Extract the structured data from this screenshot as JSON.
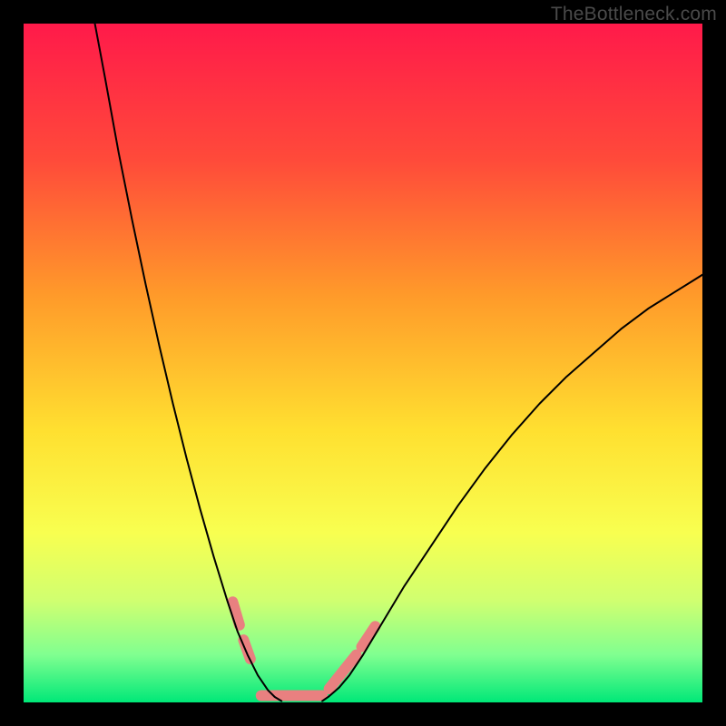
{
  "watermark": "TheBottleneck.com",
  "chart_data": {
    "type": "line",
    "title": "",
    "xlabel": "",
    "ylabel": "",
    "xlim": [
      0,
      100
    ],
    "ylim": [
      0,
      100
    ],
    "background_gradient": {
      "stops": [
        {
          "offset": 0.0,
          "color": "#ff1a4a"
        },
        {
          "offset": 0.2,
          "color": "#ff4a3a"
        },
        {
          "offset": 0.4,
          "color": "#ff9a2a"
        },
        {
          "offset": 0.6,
          "color": "#ffe030"
        },
        {
          "offset": 0.75,
          "color": "#f8ff50"
        },
        {
          "offset": 0.85,
          "color": "#d0ff70"
        },
        {
          "offset": 0.93,
          "color": "#80ff90"
        },
        {
          "offset": 1.0,
          "color": "#00e878"
        }
      ]
    },
    "series": [
      {
        "name": "left-curve",
        "color": "#000000",
        "stroke_width": 2,
        "x": [
          10.5,
          12,
          14,
          16,
          18,
          20,
          22,
          24,
          26,
          28,
          30,
          31.5,
          33,
          34.5,
          36,
          37,
          38
        ],
        "y": [
          100,
          92,
          81,
          71,
          61.5,
          52.5,
          44,
          36,
          28.5,
          21.5,
          15,
          10.5,
          7,
          4,
          1.8,
          0.8,
          0.2
        ]
      },
      {
        "name": "right-curve",
        "color": "#000000",
        "stroke_width": 2,
        "x": [
          44,
          45,
          46.5,
          48,
          50,
          53,
          56,
          60,
          64,
          68,
          72,
          76,
          80,
          84,
          88,
          92,
          96,
          100
        ],
        "y": [
          0.2,
          0.9,
          2.2,
          4,
          7,
          12,
          17,
          23,
          29,
          34.5,
          39.5,
          44,
          48,
          51.5,
          55,
          58,
          60.5,
          63
        ]
      }
    ],
    "highlight": {
      "color": "#e98080",
      "stroke_width": 12,
      "segments": [
        {
          "name": "left-dot-upper",
          "x": [
            30.8,
            31.8
          ],
          "y": [
            14.8,
            11.4
          ]
        },
        {
          "name": "left-dot-lower",
          "x": [
            32.4,
            33.4
          ],
          "y": [
            9.2,
            6.4
          ]
        },
        {
          "name": "trough-bar",
          "x": [
            35.0,
            44.0
          ],
          "y": [
            1.0,
            1.0
          ]
        },
        {
          "name": "right-stroke",
          "x": [
            45.0,
            49.0
          ],
          "y": [
            2.0,
            7.0
          ]
        },
        {
          "name": "right-dot",
          "x": [
            49.8,
            51.8
          ],
          "y": [
            8.2,
            11.2
          ]
        }
      ]
    }
  }
}
